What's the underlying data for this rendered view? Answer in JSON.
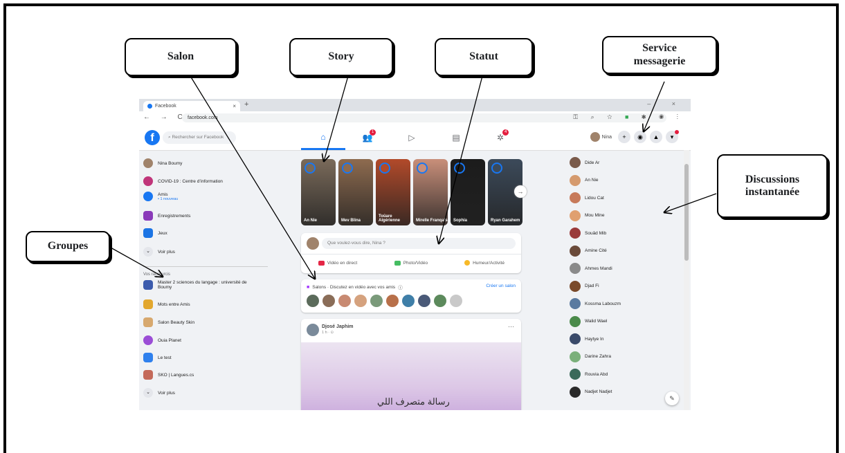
{
  "annotations": {
    "salon": "Salon",
    "story": "Story",
    "statut": "Statut",
    "service_messagerie_line1": "Service",
    "service_messagerie_line2": "messagerie",
    "groupes": "Groupes",
    "discussions_line1": "Discussions",
    "discussions_line2": "instantanée"
  },
  "browser": {
    "tab_title": "Facebook",
    "tab_close": "×",
    "new_tab": "+",
    "window_controls": "– ×",
    "address": "facebook.com",
    "nav_buttons": "← → C"
  },
  "fb": {
    "logo": "f",
    "search_placeholder": "Rechercher sur Facebook",
    "badges": {
      "friends": "1",
      "gaming": "4"
    },
    "profile_name": "Nina",
    "plus": "+"
  },
  "left_sidebar": {
    "items": [
      {
        "label": "Nina Boumy",
        "color": "#a0836b"
      },
      {
        "label": "COVID-19 : Centre d’information",
        "color": "#c0357a"
      },
      {
        "label": "Amis",
        "sub": "• 1 nouveau",
        "color": "#1877f2"
      },
      {
        "label": "Enregistrements",
        "color": "#8a3ab9"
      },
      {
        "label": "Jeux",
        "color": "#1b74e4"
      },
      {
        "label": "Voir plus",
        "color": "#e4e6eb"
      }
    ],
    "section_title": "Vos raccourcis",
    "groups": [
      {
        "label": "Master 2 sciences du langage : université de Boumy",
        "color": "#3b5bad"
      },
      {
        "label": "Mots entre Amis",
        "color": "#e2a72e"
      },
      {
        "label": "Salon Beauty Skin",
        "color": "#d7a86e"
      },
      {
        "label": "Ouia Planet",
        "color": "#9b4dd6"
      },
      {
        "label": "Le test",
        "color": "#2f80ed"
      },
      {
        "label": "SKO | Langues.cs",
        "color": "#c46a5a"
      },
      {
        "label": "Voir plus",
        "color": "#e4e6eb"
      }
    ]
  },
  "stories": [
    {
      "name": "An Nie",
      "bg": "#7a6a5a",
      "ring": "#1877f2"
    },
    {
      "name": "Mev Blina",
      "bg": "#8e6b4f",
      "ring": "#1877f2"
    },
    {
      "name": "Toûare Algérienne",
      "bg": "#b24a2a",
      "ring": "#1877f2"
    },
    {
      "name": "Mirelle Franqais",
      "bg": "#c98f7a",
      "ring": "#1877f2"
    },
    {
      "name": "Sophia",
      "bg": "#1c1c1c",
      "ring": "#1877f2"
    },
    {
      "name": "Ryan Garahem",
      "bg": "#3c4a5a",
      "ring": "#1877f2"
    }
  ],
  "composer": {
    "placeholder": "Que voulez-vous dire, Nina ?",
    "actions": [
      {
        "label": "Vidéo en direct",
        "color": "#e42645"
      },
      {
        "label": "Photo/Vidéo",
        "color": "#45bd62"
      },
      {
        "label": "Humeur/Activité",
        "color": "#f7b928"
      }
    ]
  },
  "rooms": {
    "title": "Salons · Discutez en vidéo avec vos amis",
    "info": "ⓘ",
    "create": "Créer un salon",
    "avatars": [
      "#5b6b5b",
      "#8a6d58",
      "#c88a72",
      "#d5a27e",
      "#7a9a7a",
      "#b8704a",
      "#3f7fa8",
      "#4a5a78",
      "#5c8a5c",
      "#c9c9c9"
    ]
  },
  "post": {
    "author": "Djosé Japhim",
    "meta": "1 h · ⊙",
    "more": "···",
    "text": "رسالة متصرف اللي"
  },
  "contacts": [
    {
      "name": "Dide Ar",
      "color": "#7a5a4a"
    },
    {
      "name": "An Nie",
      "color": "#d59a6e"
    },
    {
      "name": "Lidou Cat",
      "color": "#c77a5a"
    },
    {
      "name": "Mou Mine",
      "color": "#e0a070"
    },
    {
      "name": "Souâd Mib",
      "color": "#9a3a3a"
    },
    {
      "name": "Amine Cité",
      "color": "#6a4a3a"
    },
    {
      "name": "Ahmes Mandi",
      "color": "#8a8a8a"
    },
    {
      "name": "Djad Fi",
      "color": "#7a4a2a"
    },
    {
      "name": "Kossma Labouzm",
      "color": "#5a7aa0"
    },
    {
      "name": "Walid Wael",
      "color": "#4a8a4a"
    },
    {
      "name": "Haytye In",
      "color": "#3a4a6a"
    },
    {
      "name": "Darine Zahra",
      "color": "#7ab07a"
    },
    {
      "name": "Rouvia Abd",
      "color": "#3a6a5a"
    },
    {
      "name": "Nadjet Nadjet",
      "color": "#2a2a2a"
    }
  ]
}
